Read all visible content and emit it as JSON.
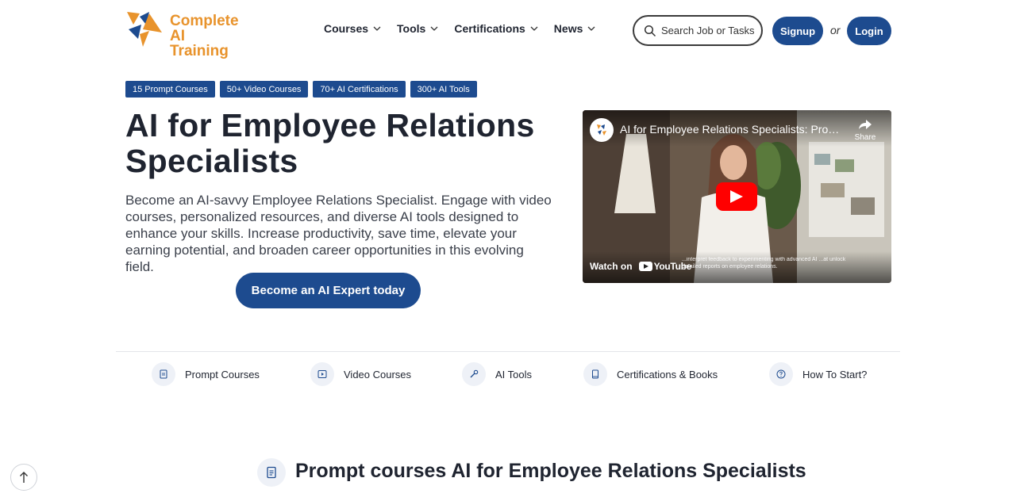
{
  "brand": {
    "line1": "Complete",
    "line2": "AI Training",
    "color": "#e8932c"
  },
  "nav": {
    "items": [
      {
        "label": "Courses",
        "icon": "chevron-down-icon"
      },
      {
        "label": "Tools",
        "icon": "chevron-down-icon"
      },
      {
        "label": "Certifications",
        "icon": "chevron-down-icon"
      },
      {
        "label": "News",
        "icon": "chevron-down-icon"
      }
    ]
  },
  "search": {
    "placeholder": "Search Job or Tasks",
    "icon": "search-icon"
  },
  "auth": {
    "signup": "Signup",
    "or": "or",
    "login": "Login"
  },
  "badges": [
    "15 Prompt Courses",
    "50+ Video Courses",
    "70+ AI Certifications",
    "300+ AI Tools"
  ],
  "hero": {
    "title": "AI for Employee Relations Specialists",
    "description": "Become an AI-savvy Employee Relations Specialist. Engage with video courses, personalized resources, and diverse AI tools designed to enhance your skills. Increase productivity, save time, elevate your earning potential, and broaden career opportunities in this evolving field.",
    "cta": "Become an AI Expert today"
  },
  "video": {
    "title": "AI for Employee Relations Specialists: Promp...",
    "share": "Share",
    "watch_on": "Watch on",
    "platform": "YouTube",
    "caption": "...interpret feedback to experimenting with advanced AI ...at unlock detailed reports on employee relations."
  },
  "tabs": [
    {
      "label": "Prompt Courses",
      "icon": "document-icon"
    },
    {
      "label": "Video Courses",
      "icon": "play-icon"
    },
    {
      "label": "AI Tools",
      "icon": "wrench-icon"
    },
    {
      "label": "Certifications & Books",
      "icon": "book-icon"
    },
    {
      "label": "How To Start?",
      "icon": "question-icon"
    }
  ],
  "section": {
    "title": "Prompt courses AI for Employee Relations Specialists",
    "icon": "document-icon"
  },
  "colors": {
    "primary": "#1d4b8f",
    "accent": "#e8932c",
    "youtube": "#ff0000"
  }
}
